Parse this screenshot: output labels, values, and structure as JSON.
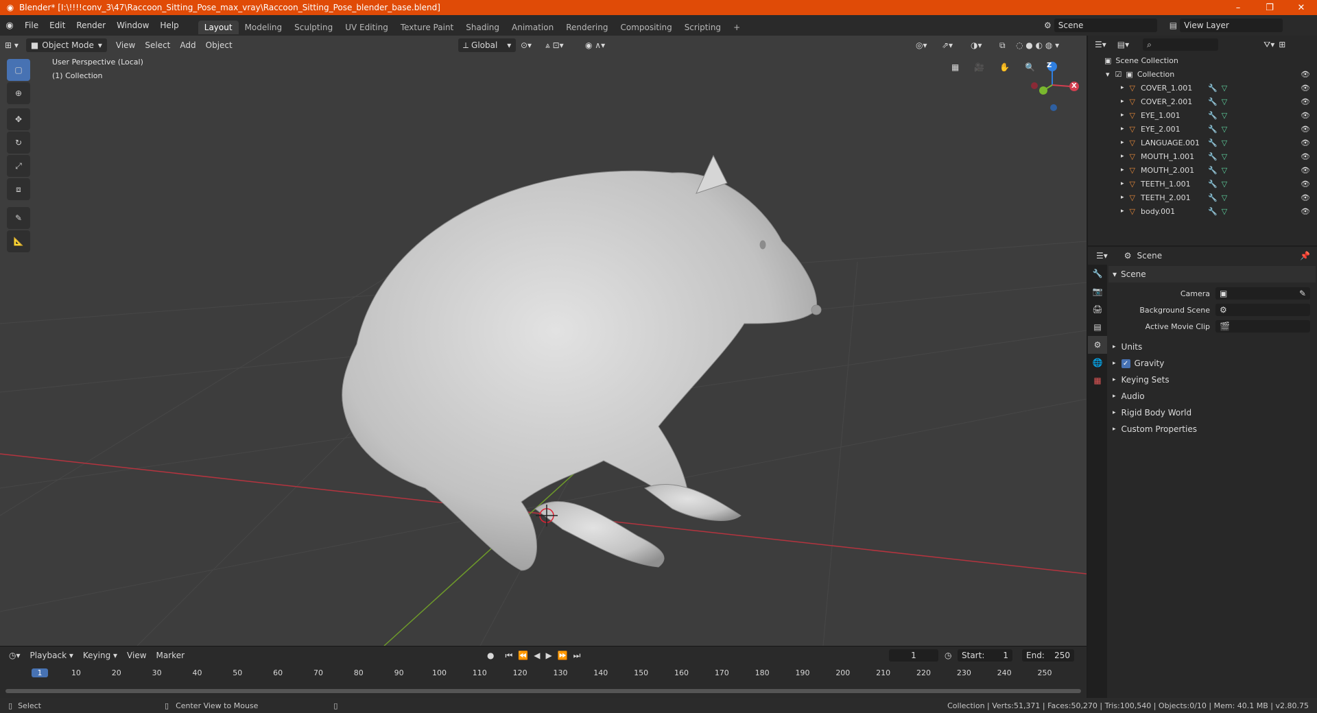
{
  "titlebar": {
    "title": "Blender* [I:\\!!!!conv_3\\47\\Raccoon_Sitting_Pose_max_vray\\Raccoon_Sitting_Pose_blender_base.blend]",
    "minimize": "–",
    "maximize": "❐",
    "close": "✕"
  },
  "menu": [
    "File",
    "Edit",
    "Render",
    "Window",
    "Help"
  ],
  "workspaces": [
    "Layout",
    "Modeling",
    "Sculpting",
    "UV Editing",
    "Texture Paint",
    "Shading",
    "Animation",
    "Rendering",
    "Compositing",
    "Scripting"
  ],
  "workspace_add": "+",
  "scene_field": "Scene",
  "view_layer_field": "View Layer",
  "viewport": {
    "mode": "Object Mode",
    "menus": [
      "View",
      "Select",
      "Add",
      "Object"
    ],
    "orientation": "Global",
    "perspective_label": "User Perspective (Local)",
    "collection_label": "(1) Collection",
    "gizmo": {
      "x": "X",
      "y": "Y",
      "z": "Z"
    }
  },
  "outliner": {
    "search_placeholder": "",
    "root": "Scene Collection",
    "collection": "Collection",
    "objects": [
      "COVER_1.001",
      "COVER_2.001",
      "EYE_1.001",
      "EYE_2.001",
      "LANGUAGE.001",
      "MOUTH_1.001",
      "MOUTH_2.001",
      "TEETH_1.001",
      "TEETH_2.001",
      "body.001"
    ]
  },
  "properties": {
    "header": "Scene",
    "panel_title": "Scene",
    "camera_label": "Camera",
    "background_scene_label": "Background Scene",
    "active_movie_clip_label": "Active Movie Clip",
    "sections": [
      "Units",
      "Gravity",
      "Keying Sets",
      "Audio",
      "Rigid Body World",
      "Custom Properties"
    ],
    "gravity_checked": true
  },
  "timeline": {
    "menus": [
      "Playback",
      "Keying",
      "View",
      "Marker"
    ],
    "current_frame": "1",
    "start_label": "Start:",
    "start_value": "1",
    "end_label": "End:",
    "end_value": "250",
    "ruler": [
      "1",
      "10",
      "20",
      "30",
      "40",
      "50",
      "60",
      "70",
      "80",
      "90",
      "100",
      "110",
      "120",
      "130",
      "140",
      "150",
      "160",
      "170",
      "180",
      "190",
      "200",
      "210",
      "220",
      "230",
      "240",
      "250"
    ]
  },
  "statusbar": {
    "select": "Select",
    "center_view": "Center View to Mouse",
    "stats": "Collection | Verts:51,371 | Faces:50,270 | Tris:100,540 | Objects:0/10 | Mem: 40.1 MB | v2.80.75"
  },
  "colors": {
    "accent": "#4772b3",
    "titlebar": "#e04b07",
    "xaxis": "#b5343f",
    "yaxis": "#6e9a2a"
  }
}
